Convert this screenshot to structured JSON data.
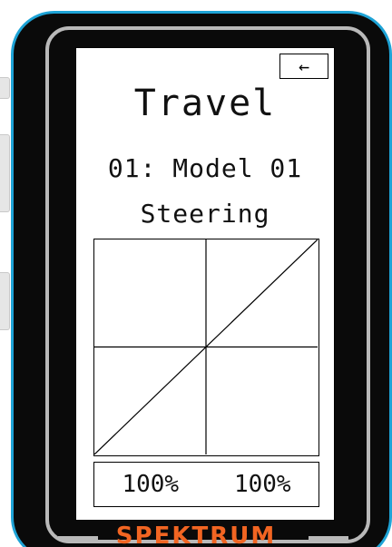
{
  "screen": {
    "back_button_icon": "back-arrow-icon",
    "back_button_glyph": "←",
    "title": "Travel",
    "model": "01: Model 01",
    "channel": "Steering",
    "travel_left": "100%",
    "travel_right": "100%"
  },
  "brand": {
    "name": "SPEKTRUM",
    "color": "#f26522"
  },
  "colors": {
    "device_border": "#1ea3d6",
    "bezel_ring": "#b9b9b9",
    "device_body": "#0a0a0a"
  },
  "chart_data": {
    "type": "line",
    "xlim": [
      -100,
      100
    ],
    "ylim": [
      -100,
      100
    ],
    "series": [
      {
        "x": [
          -100,
          100
        ],
        "y": [
          -100,
          100
        ]
      }
    ],
    "axes_crosshair": true
  }
}
